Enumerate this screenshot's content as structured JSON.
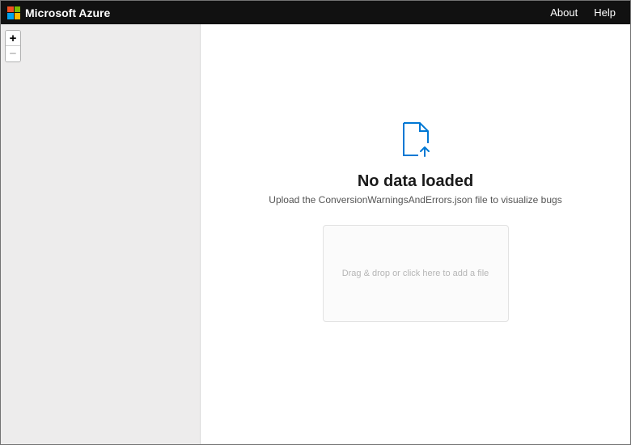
{
  "topbar": {
    "brand": "Microsoft Azure",
    "links": {
      "about": "About",
      "help": "Help"
    }
  },
  "sidebar": {
    "zoom": {
      "in": "+",
      "out": "−"
    }
  },
  "main": {
    "heading": "No data loaded",
    "subtext": "Upload the ConversionWarningsAndErrors.json file to visualize bugs",
    "dropzone": "Drag & drop or click here to add a file"
  }
}
